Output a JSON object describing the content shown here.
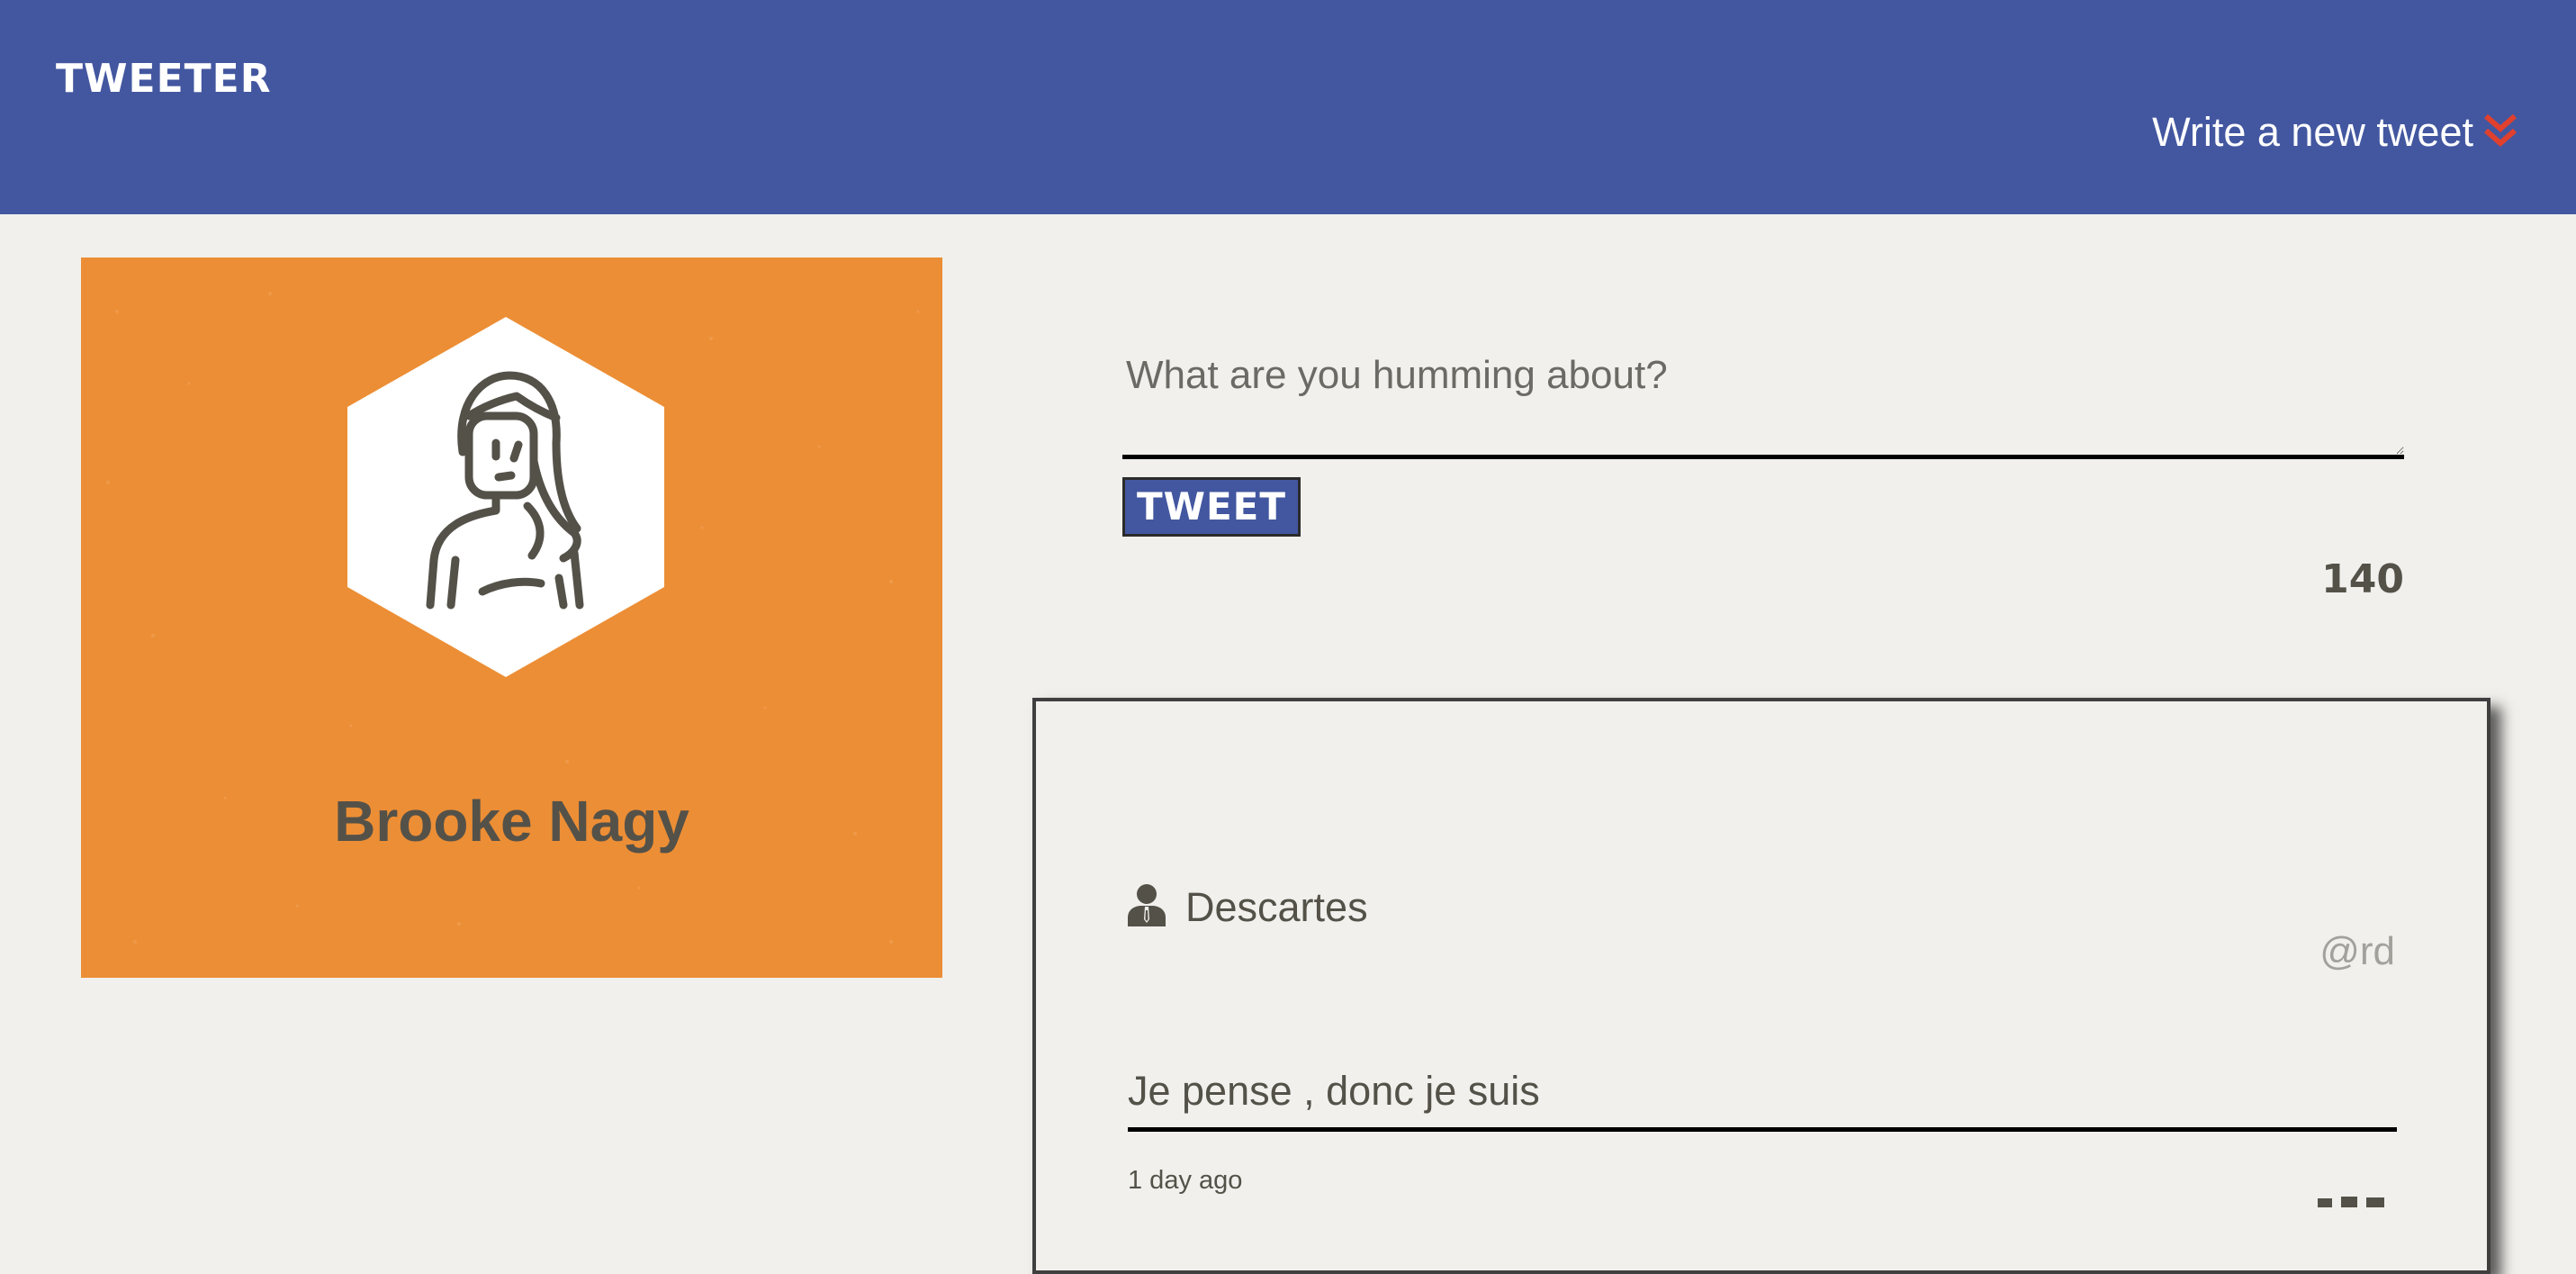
{
  "app": {
    "brand": "TWEETER"
  },
  "header": {
    "compose_label": "Write a new tweet",
    "compose_icon": "double-chevron-down-icon"
  },
  "profile": {
    "name": "Brooke Nagy",
    "avatar_icon": "user-avatar-hexagon-icon"
  },
  "composer": {
    "placeholder": "What are you humming about?",
    "value": "",
    "button_label": "TWEET",
    "counter": "140"
  },
  "tweet": {
    "author_icon": "person-icon",
    "author_name": "Descartes",
    "handle": "@rd",
    "content": "Je pense , donc je suis",
    "time": "1 day ago"
  },
  "colors": {
    "header_bg": "#4357a0",
    "page_bg": "#f1f0ec",
    "profile_bg": "#ec8e35",
    "accent_chevron": "#e0402e",
    "text_dark": "#545149",
    "handle_gray": "#a3a19c"
  }
}
